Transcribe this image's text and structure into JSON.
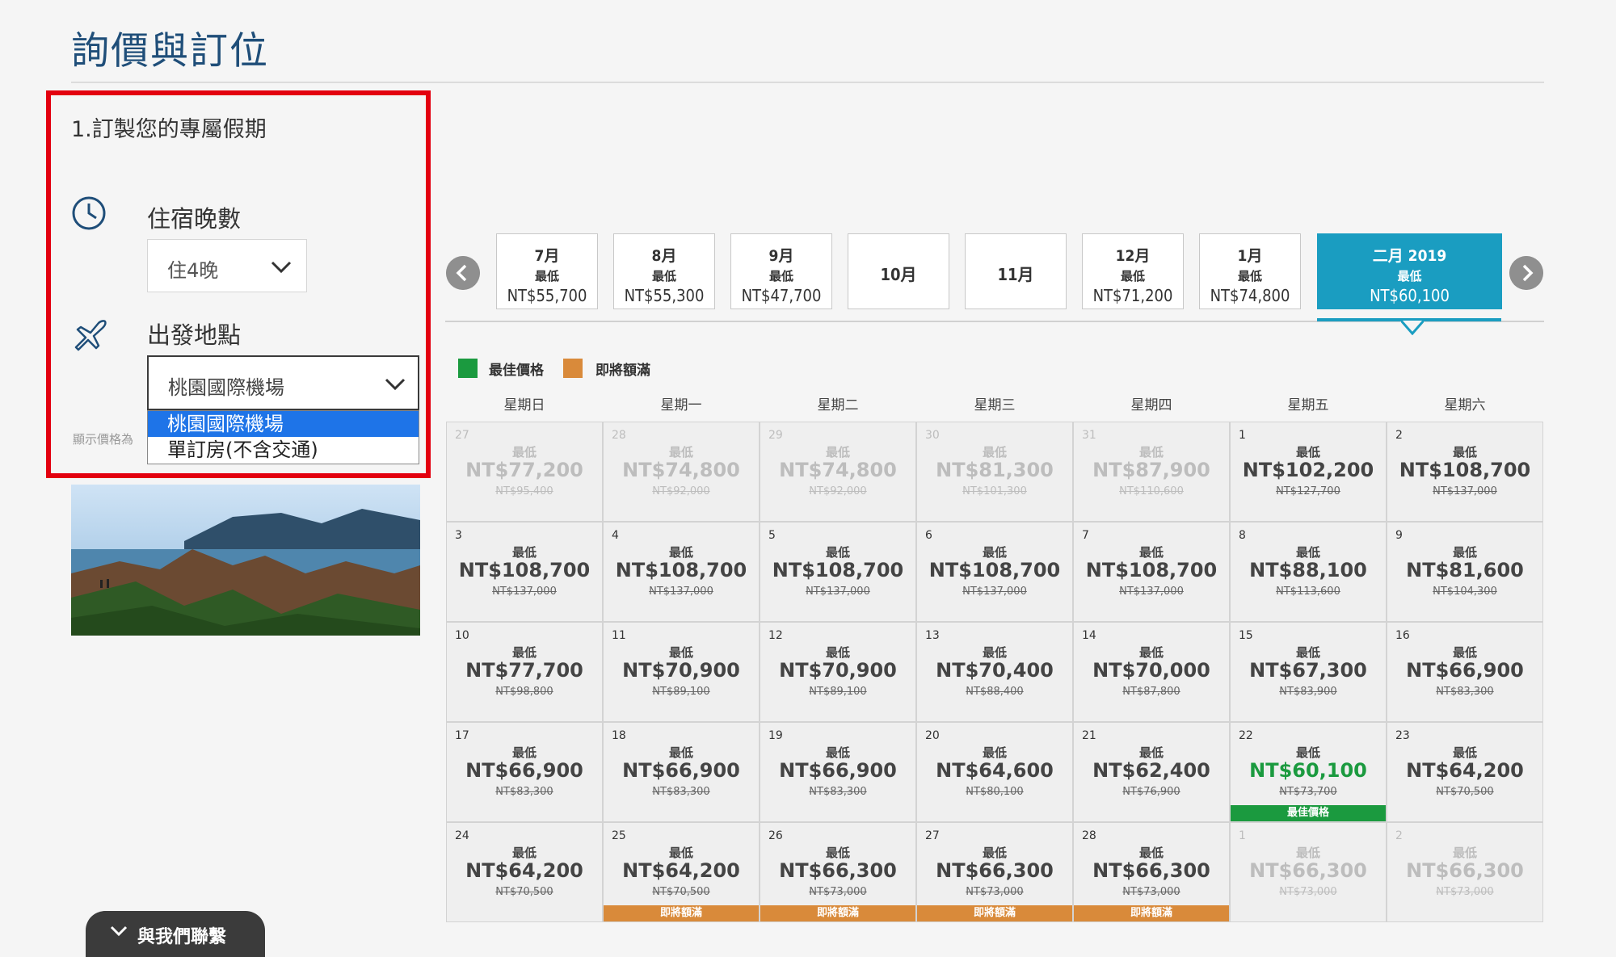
{
  "page": {
    "title": "詢價與訂位"
  },
  "step1": {
    "title": "1.訂製您的專屬假期",
    "nights_label": "住宿晚數",
    "nights_value": "住4晚",
    "origin_label": "出發地點",
    "origin_value": "桃園國際機場",
    "origin_options": [
      "桃園國際機場",
      "單訂房(不含交通)"
    ],
    "price_note": "顯示價格為"
  },
  "months": [
    {
      "name": "7月",
      "low": "最低",
      "price": "NT$55,700"
    },
    {
      "name": "8月",
      "low": "最低",
      "price": "NT$55,300"
    },
    {
      "name": "9月",
      "low": "最低",
      "price": "NT$47,700"
    },
    {
      "name": "10月",
      "low": "",
      "price": ""
    },
    {
      "name": "11月",
      "low": "",
      "price": ""
    },
    {
      "name": "12月",
      "low": "最低",
      "price": "NT$71,200"
    },
    {
      "name": "1月",
      "low": "最低",
      "price": "NT$74,800"
    },
    {
      "name": "二月 2019",
      "low": "最低",
      "price": "NT$60,100"
    }
  ],
  "legend": {
    "best": "最佳價格",
    "almost_full": "即將額滿"
  },
  "colors": {
    "accent": "#1a9dc1",
    "best": "#1b9a3f",
    "almost_full": "#d98a3a",
    "highlight": "#e3000f"
  },
  "weekdays": [
    "星期日",
    "星期一",
    "星期二",
    "星期三",
    "星期四",
    "星期五",
    "星期六"
  ],
  "calendar": [
    [
      {
        "d": "27",
        "low": "最低",
        "price": "NT$77,200",
        "orig": "NT$95,400",
        "faded": true
      },
      {
        "d": "28",
        "low": "最低",
        "price": "NT$74,800",
        "orig": "NT$92,000",
        "faded": true
      },
      {
        "d": "29",
        "low": "最低",
        "price": "NT$74,800",
        "orig": "NT$92,000",
        "faded": true
      },
      {
        "d": "30",
        "low": "最低",
        "price": "NT$81,300",
        "orig": "NT$101,300",
        "faded": true
      },
      {
        "d": "31",
        "low": "最低",
        "price": "NT$87,900",
        "orig": "NT$110,600",
        "faded": true
      },
      {
        "d": "1",
        "low": "最低",
        "price": "NT$102,200",
        "orig": "NT$127,700"
      },
      {
        "d": "2",
        "low": "最低",
        "price": "NT$108,700",
        "orig": "NT$137,000"
      }
    ],
    [
      {
        "d": "3",
        "low": "最低",
        "price": "NT$108,700",
        "orig": "NT$137,000"
      },
      {
        "d": "4",
        "low": "最低",
        "price": "NT$108,700",
        "orig": "NT$137,000"
      },
      {
        "d": "5",
        "low": "最低",
        "price": "NT$108,700",
        "orig": "NT$137,000"
      },
      {
        "d": "6",
        "low": "最低",
        "price": "NT$108,700",
        "orig": "NT$137,000"
      },
      {
        "d": "7",
        "low": "最低",
        "price": "NT$108,700",
        "orig": "NT$137,000"
      },
      {
        "d": "8",
        "low": "最低",
        "price": "NT$88,100",
        "orig": "NT$113,600"
      },
      {
        "d": "9",
        "low": "最低",
        "price": "NT$81,600",
        "orig": "NT$104,300"
      }
    ],
    [
      {
        "d": "10",
        "low": "最低",
        "price": "NT$77,700",
        "orig": "NT$98,800"
      },
      {
        "d": "11",
        "low": "最低",
        "price": "NT$70,900",
        "orig": "NT$89,100"
      },
      {
        "d": "12",
        "low": "最低",
        "price": "NT$70,900",
        "orig": "NT$89,100"
      },
      {
        "d": "13",
        "low": "最低",
        "price": "NT$70,400",
        "orig": "NT$88,400"
      },
      {
        "d": "14",
        "low": "最低",
        "price": "NT$70,000",
        "orig": "NT$87,800"
      },
      {
        "d": "15",
        "low": "最低",
        "price": "NT$67,300",
        "orig": "NT$83,900"
      },
      {
        "d": "16",
        "low": "最低",
        "price": "NT$66,900",
        "orig": "NT$83,300"
      }
    ],
    [
      {
        "d": "17",
        "low": "最低",
        "price": "NT$66,900",
        "orig": "NT$83,300"
      },
      {
        "d": "18",
        "low": "最低",
        "price": "NT$66,900",
        "orig": "NT$83,300"
      },
      {
        "d": "19",
        "low": "最低",
        "price": "NT$66,900",
        "orig": "NT$83,300"
      },
      {
        "d": "20",
        "low": "最低",
        "price": "NT$64,600",
        "orig": "NT$80,100"
      },
      {
        "d": "21",
        "low": "最低",
        "price": "NT$62,400",
        "orig": "NT$76,900"
      },
      {
        "d": "22",
        "low": "最低",
        "price": "NT$60,100",
        "orig": "NT$73,700",
        "badge": "最佳價格",
        "best": true
      },
      {
        "d": "23",
        "low": "最低",
        "price": "NT$64,200",
        "orig": "NT$70,500"
      }
    ],
    [
      {
        "d": "24",
        "low": "最低",
        "price": "NT$64,200",
        "orig": "NT$70,500"
      },
      {
        "d": "25",
        "low": "最低",
        "price": "NT$64,200",
        "orig": "NT$70,500",
        "badge": "即將額滿"
      },
      {
        "d": "26",
        "low": "最低",
        "price": "NT$66,300",
        "orig": "NT$73,000",
        "badge": "即將額滿"
      },
      {
        "d": "27",
        "low": "最低",
        "price": "NT$66,300",
        "orig": "NT$73,000",
        "badge": "即將額滿"
      },
      {
        "d": "28",
        "low": "最低",
        "price": "NT$66,300",
        "orig": "NT$73,000",
        "badge": "即將額滿"
      },
      {
        "d": "1",
        "low": "最低",
        "price": "NT$66,300",
        "orig": "NT$73,000",
        "faded": true
      },
      {
        "d": "2",
        "low": "最低",
        "price": "NT$66,300",
        "orig": "NT$73,000",
        "faded": true
      }
    ]
  ],
  "contact": {
    "label": "與我們聯繫"
  }
}
